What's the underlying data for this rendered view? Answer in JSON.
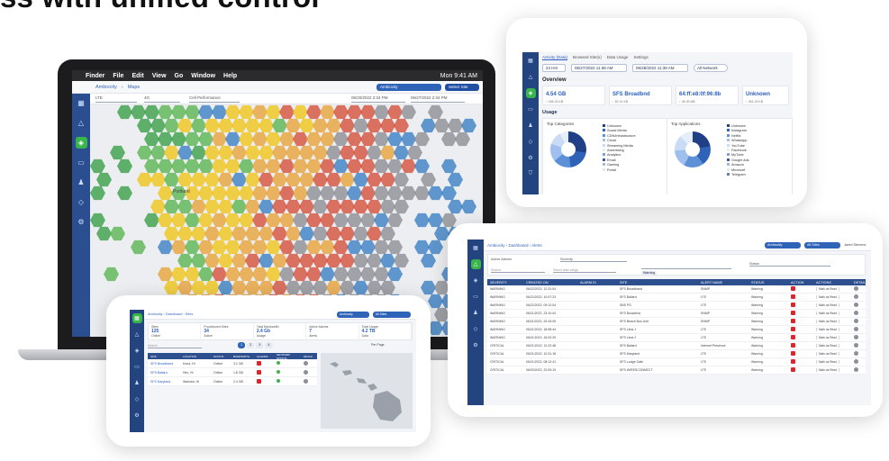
{
  "headline": "ss with unified control",
  "mac_menubar": {
    "items": [
      "Finder",
      "File",
      "Edit",
      "View",
      "Go",
      "Window",
      "Help"
    ],
    "clock": "Mon 9:41 AM"
  },
  "laptop_app": {
    "breadcrumb": [
      "Ambiocity",
      "Maps"
    ],
    "site_selector": "Ambiocity",
    "select_site_button": "Select Site",
    "filters": [
      "LTE",
      "4G",
      "Cell Performance"
    ],
    "date_from": "06/20/2022 2:34 PM",
    "date_to": "06/27/2022 2:34 PM",
    "map_label": "Portland"
  },
  "activity_card": {
    "tabs": [
      "Activity (Data)",
      "Browsed Site(s)",
      "Data Usage",
      "Settings"
    ],
    "range": "24 Hrs",
    "start_label": "06/27/2022 11:38 AM",
    "end_label": "06/28/2022 11:38 AM",
    "filter_chip": "All Network",
    "overview_title": "Overview",
    "stats": [
      {
        "value": "4.54 GB",
        "sub": "↑ 186.15 KB"
      },
      {
        "value": "SFS Broadbnd",
        "sub": "↑ 52.14 KB"
      },
      {
        "value": "64:ff:e8:0f:96:8b",
        "sub": "↑ 45.39 MB"
      },
      {
        "value": "Unknown",
        "sub": "↑ 451.33 KB"
      }
    ],
    "usage_title": "Usage",
    "panel_titles": [
      "Top Categories",
      "Top Applications"
    ],
    "categories": [
      "Unknown",
      "Social Media",
      "CDN/Infrastructure",
      "Cloud",
      "Streaming Media",
      "Advertising",
      "Analytics",
      "Email",
      "Gaming",
      "Portal"
    ],
    "applications": [
      "Unknown",
      "Instagram",
      "Netflix",
      "WhatsApp",
      "YouTube",
      "Facebook",
      "MyTube",
      "Google Ads",
      "Amazon",
      "Microsoft",
      "Telegram"
    ]
  },
  "alerts_card": {
    "breadcrumb": [
      "Ambiocity",
      "Dashboard",
      "Alerts"
    ],
    "site_selector": "Ambiocity",
    "scope_selector": "All Sites",
    "user": "Jared Stevens",
    "filter_labels": [
      "Active Alarms",
      "Severity",
      "Status"
    ],
    "status_value": "Warning",
    "search_placeholder": "Search",
    "date_placeholder": "Select date range",
    "columns": [
      "SEVERITY",
      "CREATED ON",
      "ALARM ID",
      "SITE",
      "ALERT NAME",
      "STATUS",
      "ACTION",
      "ACTIONS",
      "DETAILS"
    ],
    "rows": [
      [
        "WARNING",
        "06/22/2022, 12:31:04",
        "",
        "SFS Broadband",
        "SNMP",
        "Warning"
      ],
      [
        "WARNING",
        "06/22/2022, 10:07:23",
        "",
        "SFS Ballard",
        "LTE",
        "Warning"
      ],
      [
        "WARNING",
        "06/22/2022, 09:12:04",
        "",
        "SBS PG",
        "LTE",
        "Warning"
      ],
      [
        "WARNING",
        "06/21/2022, 23:10:04",
        "",
        "SFS Broadbnd",
        "SNMP",
        "Warning"
      ],
      [
        "WARNING",
        "06/21/2022, 20:43:05",
        "",
        "SFS Beach Bus Unit",
        "SNMP",
        "Warning"
      ],
      [
        "WARNING",
        "06/21/2022, 18:58:44",
        "",
        "SFS Lima 1",
        "LTE",
        "Warning"
      ],
      [
        "WARNING",
        "06/21/2022, 15:02:29",
        "",
        "SFS Lima 2",
        "LTE",
        "Warning"
      ],
      [
        "CRITICAL",
        "06/21/2022, 12:22:48",
        "",
        "SFS Ballard",
        "Internet Presence",
        "Warning"
      ],
      [
        "CRITICAL",
        "06/21/2022, 10:31:18",
        "",
        "SFS Maryland",
        "LTE",
        "Warning"
      ],
      [
        "CRITICAL",
        "06/21/2022, 08:12:41",
        "",
        "SFS Lodge Gate",
        "LTE",
        "Warning"
      ],
      [
        "CRITICAL",
        "06/20/2022, 22:53:19",
        "",
        "SFS WIRESCONNECT",
        "LTE",
        "Warning"
      ]
    ],
    "action_label": "Mark as Read"
  },
  "sites_card": {
    "breadcrumb": [
      "Ambiocity",
      "Dashboard",
      "Sites"
    ],
    "site_selector": "Ambiocity",
    "scope_selector": "All Sites",
    "summary": [
      {
        "title": "Sites",
        "value": "125",
        "sub": "Online"
      },
      {
        "title": "Provisioned Sites",
        "value": "34",
        "sub": "Active"
      },
      {
        "title": "Total Bandwidth",
        "value": "2.4 Gb",
        "sub": "Usage"
      },
      {
        "title": "Active Alarms",
        "value": "7",
        "sub": "Alerts"
      },
      {
        "title": "Total Usage",
        "value": "4.2 TB",
        "sub": "Data"
      }
    ],
    "search_placeholder": "Search",
    "page_label": "Per Page",
    "columns": [
      "SITE",
      "LOCATION",
      "STATUS",
      "BANDWIDTH",
      "ALARMS",
      "NETWORK STATUS",
      "DETAIL"
    ],
    "rows": [
      [
        "SFS Broadband",
        "Kona, HI",
        "Online",
        "3.2 GB"
      ],
      [
        "SFS Ballard",
        "Hilo, HI",
        "Online",
        "1.8 GB"
      ],
      [
        "SFS Maryland",
        "Waimea, HI",
        "Online",
        "2.4 GB"
      ]
    ]
  }
}
